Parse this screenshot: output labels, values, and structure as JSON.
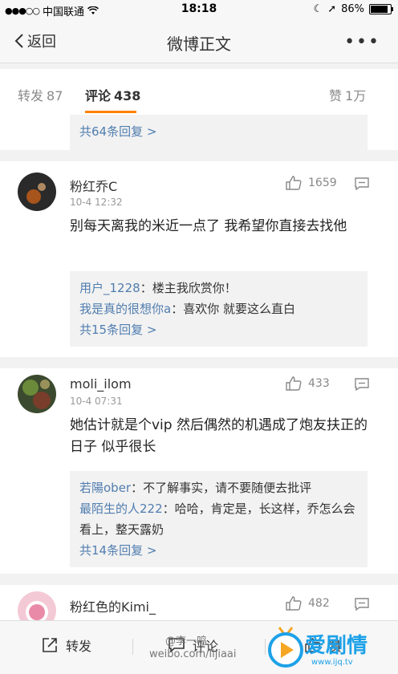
{
  "status": {
    "carrier": "中国联通",
    "time": "18:18",
    "battery": "86%"
  },
  "nav": {
    "back": "返回",
    "title": "微博正文"
  },
  "tabs": [
    {
      "label": "转发",
      "count": "87"
    },
    {
      "label": "评论",
      "count": "438"
    },
    {
      "label": "赞",
      "count": "1万"
    }
  ],
  "prev_card": {
    "more": "共64条回复 >"
  },
  "comments": [
    {
      "name": "粉红乔C",
      "time": "10-4 12:32",
      "likes": "1659",
      "text": "别每天离我的米近一点了 我希望你直接去找他",
      "replies": [
        {
          "user": "用户_1228",
          "text": "：楼主我欣赏你！"
        },
        {
          "user": "我是真的很想你a",
          "text": "：喜欢你 就要这么直白"
        }
      ],
      "more": "共15条回复 >"
    },
    {
      "name": "moli_ilom",
      "time": "10-4 07:31",
      "likes": "433",
      "text": "她估计就是个vip 然后偶然的机遇成了炮友扶正的日子 似乎很长",
      "replies": [
        {
          "user": "若陽ober",
          "text": "：不了解事实，请不要随便去批评"
        },
        {
          "user": "最陌生的人222",
          "text": "：哈哈，肯定是，长这样，乔怎么会看上，整天露奶"
        }
      ],
      "more": "共14条回复 >"
    },
    {
      "name": "粉红色的Kimi_",
      "likes": "482"
    }
  ],
  "bottom": {
    "repost": "转发",
    "comment": "评论",
    "like": "赞"
  },
  "watermark": {
    "line1": "@李一鸣",
    "line2": "weibo.com/lijiaai"
  },
  "logo": {
    "brand": "爱剧情",
    "site": "www.ijq.tv"
  },
  "colors": {
    "accent": "#ff8200",
    "link": "#507daf"
  }
}
